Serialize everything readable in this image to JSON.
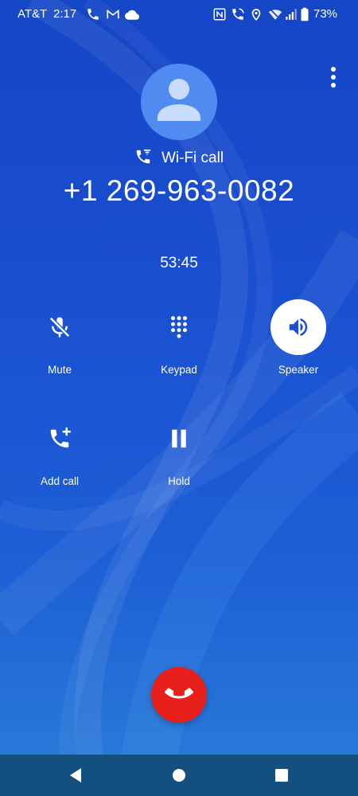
{
  "status_bar": {
    "carrier": "AT&T",
    "time": "2:17",
    "battery": "73%",
    "left_icons": [
      "phone-icon",
      "gmail-icon",
      "cloud-icon"
    ],
    "right_icons": [
      "nfc-icon",
      "wifi-calling-icon",
      "location-icon",
      "wifi-signal-icon",
      "cell-signal-icon",
      "battery-icon"
    ]
  },
  "call": {
    "call_type": "Wi-Fi call",
    "number": "+1 269-963-0082",
    "timer": "53:45"
  },
  "actions": {
    "mute": {
      "label": "Mute",
      "icon": "mic-off-icon",
      "active": false
    },
    "keypad": {
      "label": "Keypad",
      "icon": "dialpad-icon",
      "active": false
    },
    "speaker": {
      "label": "Speaker",
      "icon": "speaker-icon",
      "active": true
    },
    "add_call": {
      "label": "Add call",
      "icon": "add-call-icon",
      "active": false
    },
    "hold": {
      "label": "Hold",
      "icon": "pause-icon",
      "active": false
    }
  },
  "colors": {
    "background": "#1a4fd0",
    "end_call": "#e8201b",
    "avatar": "#4f8bf0",
    "nav_bar": "#13507f",
    "active_button": "#ffffff",
    "active_icon": "#1a4fd0"
  },
  "nav": {
    "back": "back-icon",
    "home": "home-icon",
    "recents": "recents-icon"
  }
}
